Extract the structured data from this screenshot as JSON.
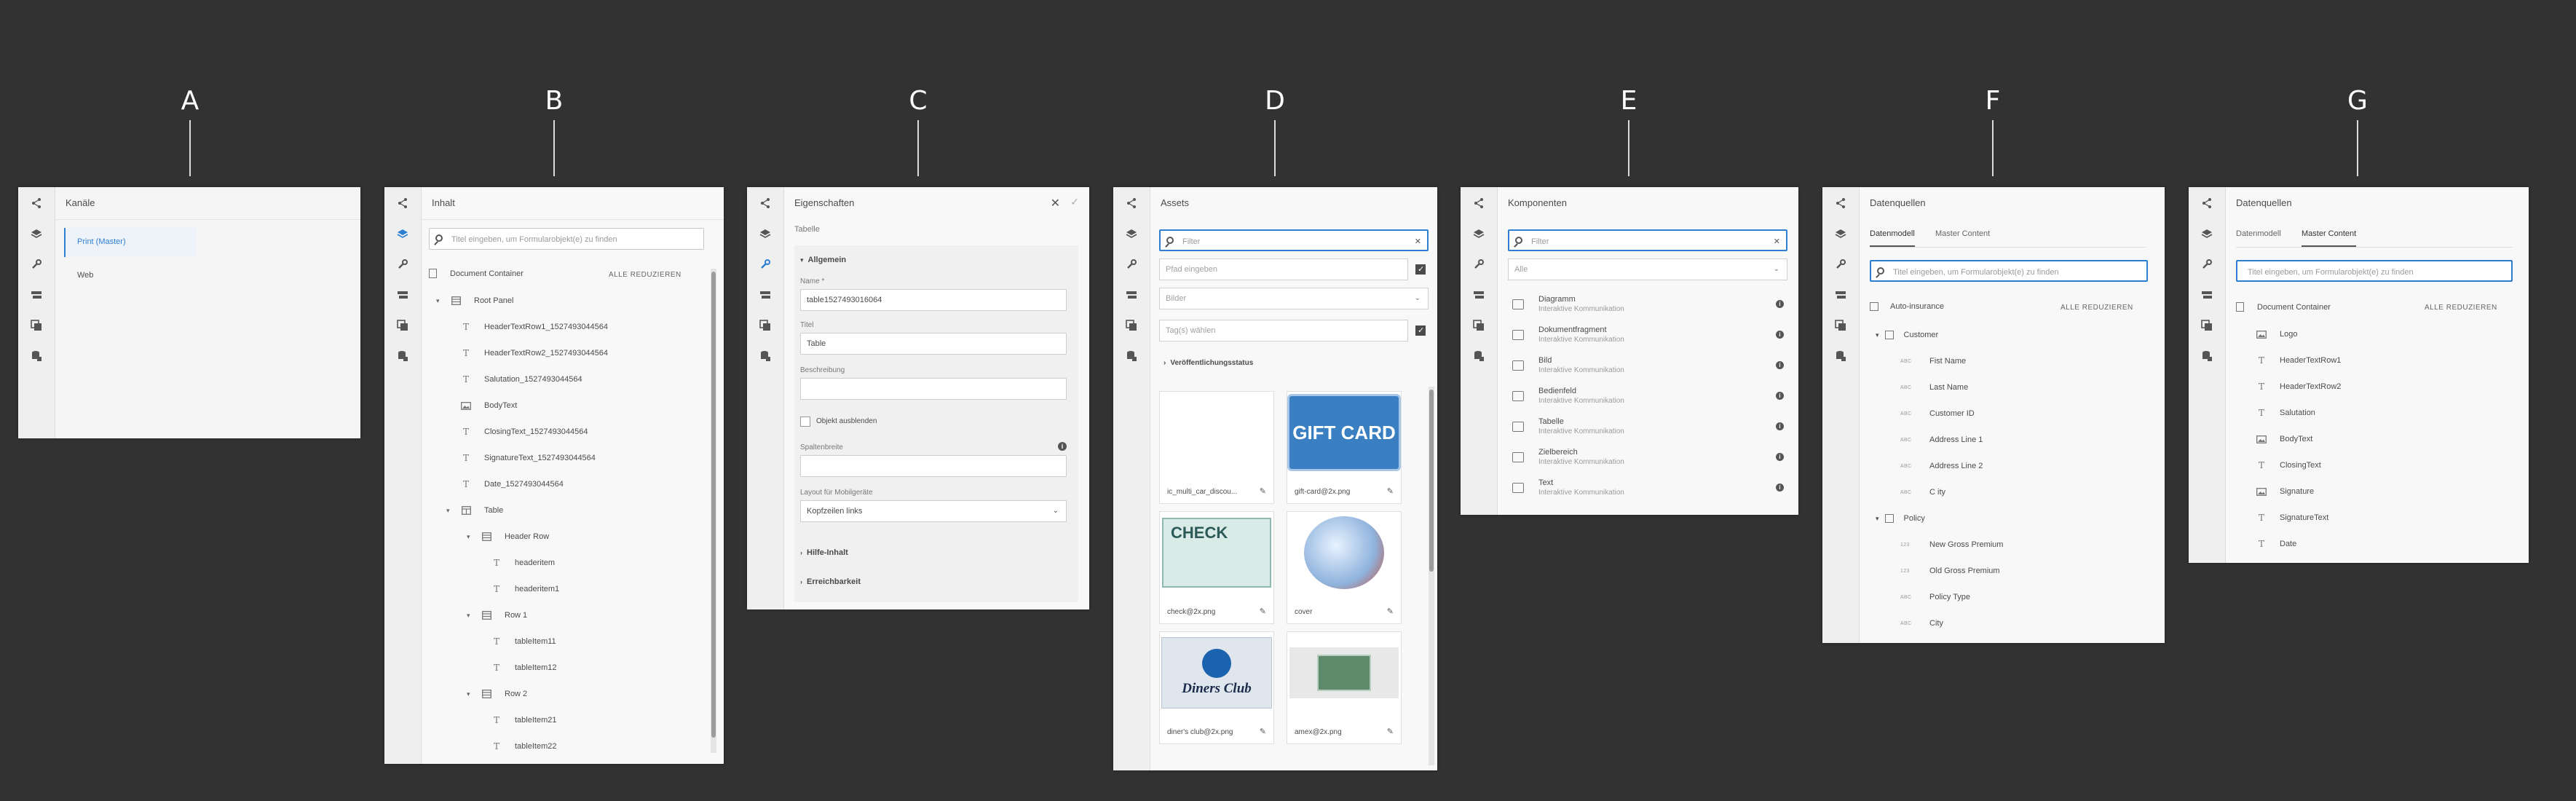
{
  "labels": [
    "A",
    "B",
    "C",
    "D",
    "E",
    "F",
    "G"
  ],
  "colors": {
    "background": "#323232",
    "accent": "#2d7fd1",
    "panel": "#f5f5f5"
  },
  "panelA": {
    "title": "Kanäle",
    "items": [
      {
        "label": "Print (Master)",
        "active": true
      },
      {
        "label": "Web",
        "active": false
      }
    ]
  },
  "panelB": {
    "title": "Inhalt",
    "search_placeholder": "Titel eingeben, um Formularobjekt(e) zu finden",
    "collapse_all": "ALLE REDUZIEREN",
    "root": "Document Container",
    "tree": [
      {
        "label": "Root Panel",
        "icon": "panel-icon",
        "level": 0,
        "chevron": "open"
      },
      {
        "label": "HeaderTextRow1_1527493044564",
        "icon": "text-icon",
        "level": 1
      },
      {
        "label": "HeaderTextRow2_1527493044564",
        "icon": "text-icon",
        "level": 1
      },
      {
        "label": "Salutation_1527493044564",
        "icon": "text-icon",
        "level": 1
      },
      {
        "label": "BodyText",
        "icon": "image-text-icon",
        "level": 1
      },
      {
        "label": "ClosingText_1527493044564",
        "icon": "text-icon",
        "level": 1
      },
      {
        "label": "SignatureText_1527493044564",
        "icon": "text-icon",
        "level": 1
      },
      {
        "label": "Date_1527493044564",
        "icon": "text-icon",
        "level": 1
      },
      {
        "label": "Table",
        "icon": "table-icon",
        "level": 1,
        "chevron": "open"
      },
      {
        "label": "Header Row",
        "icon": "row-icon",
        "level": 2,
        "chevron": "open"
      },
      {
        "label": "headeritem",
        "icon": "text-icon",
        "level": 3
      },
      {
        "label": "headeritem1",
        "icon": "text-icon",
        "level": 3
      },
      {
        "label": "Row 1",
        "icon": "row-icon",
        "level": 2,
        "chevron": "open"
      },
      {
        "label": "tableItem11",
        "icon": "text-icon",
        "level": 3
      },
      {
        "label": "tableItem12",
        "icon": "text-icon",
        "level": 3
      },
      {
        "label": "Row 2",
        "icon": "row-icon",
        "level": 2,
        "chevron": "open"
      },
      {
        "label": "tableItem21",
        "icon": "text-icon",
        "level": 3
      },
      {
        "label": "tableItem22",
        "icon": "text-icon",
        "level": 3
      }
    ]
  },
  "panelC": {
    "title": "Eigenschaften",
    "subtitle": "Tabelle",
    "section_general": "Allgemein",
    "name_label": "Name *",
    "name_value": "table1527493016064",
    "title_label": "Titel",
    "title_value": "Table",
    "description_label": "Beschreibung",
    "hide_object_label": "Objekt ausblenden",
    "column_width_label": "Spaltenbreite",
    "layout_label": "Layout für Mobilgeräte",
    "layout_value": "Kopfzeilen links",
    "help_section": "Hilfe-Inhalt",
    "accessibility_section": "Erreichbarkeit"
  },
  "panelD": {
    "title": "Assets",
    "filter_placeholder": "Filter",
    "path_placeholder": "Pfad eingeben",
    "type_placeholder": "Bilder",
    "tags_placeholder": "Tag(s) wählen",
    "publish_status": "Veröffentlichungsstatus",
    "assets": [
      {
        "name": "ic_multi_car_discou...",
        "kind": "blank"
      },
      {
        "name": "gift-card@2x.png",
        "kind": "gift",
        "text": "GIFT CARD"
      },
      {
        "name": "check@2x.png",
        "kind": "check",
        "text": "CHECK"
      },
      {
        "name": "cover",
        "kind": "globe"
      },
      {
        "name": "diner's club@2x.png",
        "kind": "diners",
        "text": "Diners Club"
      },
      {
        "name": "amex@2x.png",
        "kind": "amex"
      }
    ]
  },
  "panelE": {
    "title": "Komponenten",
    "filter_placeholder": "Filter",
    "group_placeholder": "Alle",
    "components": [
      {
        "name": "Diagramm",
        "group": "Interaktive Kommunikation",
        "icon": "chart-icon"
      },
      {
        "name": "Dokumentfragment",
        "group": "Interaktive Kommunikation",
        "icon": "fragment-icon"
      },
      {
        "name": "Bild",
        "group": "Interaktive Kommunikation",
        "icon": "image-icon"
      },
      {
        "name": "Bedienfeld",
        "group": "Interaktive Kommunikation",
        "icon": "panel-icon"
      },
      {
        "name": "Tabelle",
        "group": "Interaktive Kommunikation",
        "icon": "table-icon"
      },
      {
        "name": "Zielbereich",
        "group": "Interaktive Kommunikation",
        "icon": "target-icon"
      },
      {
        "name": "Text",
        "group": "Interaktive Kommunikation",
        "icon": "text-icon"
      }
    ]
  },
  "panelF": {
    "title": "Datenquellen",
    "tabs": [
      "Datenmodell",
      "Master Content"
    ],
    "active_tab": 0,
    "search_placeholder": "Titel eingeben, um Formularobjekt(e) zu finden",
    "root": "Auto-insurance",
    "collapse_all": "ALLE REDUZIEREN",
    "rows": [
      {
        "label": "Customer",
        "type": "",
        "level": 0,
        "chevron": true
      },
      {
        "label": "Fist Name",
        "type": "ABC",
        "level": 1
      },
      {
        "label": "Last Name",
        "type": "ABC",
        "level": 1
      },
      {
        "label": "Customer ID",
        "type": "ABC",
        "level": 1
      },
      {
        "label": "Address Line 1",
        "type": "ABC",
        "level": 1
      },
      {
        "label": "Address Line 2",
        "type": "ABC",
        "level": 1
      },
      {
        "label": "C ity",
        "type": "ABC",
        "level": 1
      },
      {
        "label": "Policy",
        "type": "",
        "level": 0,
        "chevron": true
      },
      {
        "label": "New Gross Premium",
        "type": "123",
        "level": 1
      },
      {
        "label": "Old Gross Premium",
        "type": "123",
        "level": 1
      },
      {
        "label": "Policy Type",
        "type": "ABC",
        "level": 1
      },
      {
        "label": "City",
        "type": "ABC",
        "level": 1
      }
    ]
  },
  "panelG": {
    "title": "Datenquellen",
    "tabs": [
      "Datenmodell",
      "Master Content"
    ],
    "active_tab": 1,
    "search_placeholder": "Titel eingeben, um Formularobjekt(e) zu finden",
    "root": "Document Container",
    "collapse_all": "ALLE REDUZIEREN",
    "rows": [
      {
        "label": "Logo",
        "icon": "image-icon"
      },
      {
        "label": "HeaderTextRow1",
        "icon": "text-icon"
      },
      {
        "label": "HeaderTextRow2",
        "icon": "text-icon"
      },
      {
        "label": "Salutation",
        "icon": "text-icon"
      },
      {
        "label": "BodyText",
        "icon": "image-text-icon"
      },
      {
        "label": "ClosingText",
        "icon": "text-icon"
      },
      {
        "label": "Signature",
        "icon": "image-icon"
      },
      {
        "label": "SignatureText",
        "icon": "text-icon"
      },
      {
        "label": "Date",
        "icon": "text-icon"
      }
    ]
  }
}
